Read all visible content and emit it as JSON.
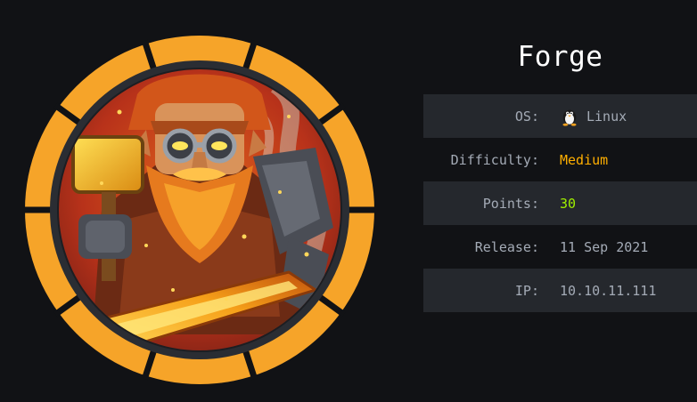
{
  "machine": {
    "name": "Forge"
  },
  "info": {
    "os": {
      "label": "OS:",
      "value": "Linux",
      "icon": "tux-penguin-icon"
    },
    "difficulty": {
      "label": "Difficulty:",
      "value": "Medium",
      "color": "#ffaf00"
    },
    "points": {
      "label": "Points:",
      "value": "30",
      "color": "#9fef00"
    },
    "release": {
      "label": "Release:",
      "value": "11 Sep 2021"
    },
    "ip": {
      "label": "IP:",
      "value": "10.10.11.111"
    }
  },
  "colors": {
    "background": "#111215",
    "row_shade": "#25282d",
    "badge_ring": "#f6a429",
    "text": "#a4abb6"
  }
}
